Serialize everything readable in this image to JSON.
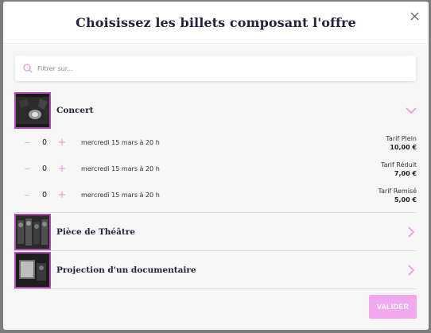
{
  "modal": {
    "title": "Choisissez les billets composant l'offre",
    "close_icon": "close-icon"
  },
  "search": {
    "placeholder": "Filtrer sur...",
    "value": "",
    "icon": "search-icon"
  },
  "events": [
    {
      "name": "Concert",
      "expanded": true,
      "chevron_icon": "chevron-down-icon",
      "tickets": [
        {
          "quantity": "0",
          "date": "mercredi 15 mars à 20 h",
          "tarif": "Tarif Plein",
          "price": "10,00 €"
        },
        {
          "quantity": "0",
          "date": "mercredi 15 mars à 20 h",
          "tarif": "Tarif Réduit",
          "price": "7,00 €"
        },
        {
          "quantity": "0",
          "date": "mercredi 15 mars à 20 h",
          "tarif": "Tarif Remisé",
          "price": "5,00 €"
        }
      ]
    },
    {
      "name": "Pièce de Théâtre",
      "expanded": false,
      "chevron_icon": "chevron-right-icon"
    },
    {
      "name": "Projection d'un documentaire",
      "expanded": false,
      "chevron_icon": "chevron-right-icon"
    }
  ],
  "actions": {
    "validate_label": "VALIDER"
  },
  "colors": {
    "accent": "#e79be3",
    "button": "#f2a8ee",
    "thumb_border": "#b14ab1",
    "title": "#1f2340"
  }
}
